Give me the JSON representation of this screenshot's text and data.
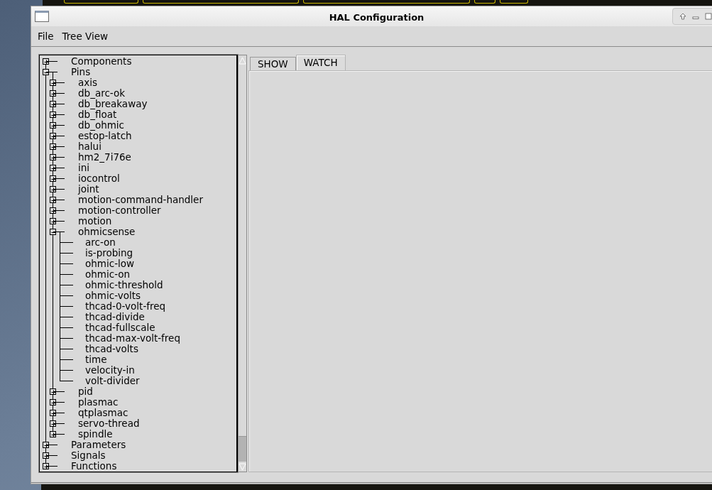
{
  "window": {
    "title": "HAL Configuration"
  },
  "menu": [
    "File",
    "Tree View"
  ],
  "tree": {
    "items": [
      {
        "label": "Components",
        "expanded": false
      },
      {
        "label": "Pins",
        "expanded": true,
        "children": [
          {
            "label": "axis",
            "expanded": false
          },
          {
            "label": "db_arc-ok",
            "expanded": false
          },
          {
            "label": "db_breakaway",
            "expanded": false
          },
          {
            "label": "db_float",
            "expanded": false
          },
          {
            "label": "db_ohmic",
            "expanded": false
          },
          {
            "label": "estop-latch",
            "expanded": false
          },
          {
            "label": "halui",
            "expanded": false
          },
          {
            "label": "hm2_7i76e",
            "expanded": false
          },
          {
            "label": "ini",
            "expanded": false
          },
          {
            "label": "iocontrol",
            "expanded": false
          },
          {
            "label": "joint",
            "expanded": false
          },
          {
            "label": "motion-command-handler",
            "expanded": false
          },
          {
            "label": "motion-controller",
            "expanded": false
          },
          {
            "label": "motion",
            "expanded": false
          },
          {
            "label": "ohmicsense",
            "expanded": true,
            "children": [
              {
                "label": "arc-on"
              },
              {
                "label": "is-probing"
              },
              {
                "label": "ohmic-low"
              },
              {
                "label": "ohmic-on"
              },
              {
                "label": "ohmic-threshold"
              },
              {
                "label": "ohmic-volts"
              },
              {
                "label": "thcad-0-volt-freq"
              },
              {
                "label": "thcad-divide"
              },
              {
                "label": "thcad-fullscale"
              },
              {
                "label": "thcad-max-volt-freq"
              },
              {
                "label": "thcad-volts"
              },
              {
                "label": "time"
              },
              {
                "label": "velocity-in"
              },
              {
                "label": "volt-divider"
              }
            ]
          },
          {
            "label": "pid",
            "expanded": false
          },
          {
            "label": "plasmac",
            "expanded": false
          },
          {
            "label": "qtplasmac",
            "expanded": false
          },
          {
            "label": "servo-thread",
            "expanded": false
          },
          {
            "label": "spindle",
            "expanded": false
          }
        ]
      },
      {
        "label": "Parameters",
        "expanded": false
      },
      {
        "label": "Signals",
        "expanded": false
      },
      {
        "label": "Functions",
        "expanded": false
      }
    ]
  },
  "tabs": [
    {
      "label": "SHOW",
      "selected": false
    },
    {
      "label": "WATCH",
      "selected": true
    }
  ]
}
